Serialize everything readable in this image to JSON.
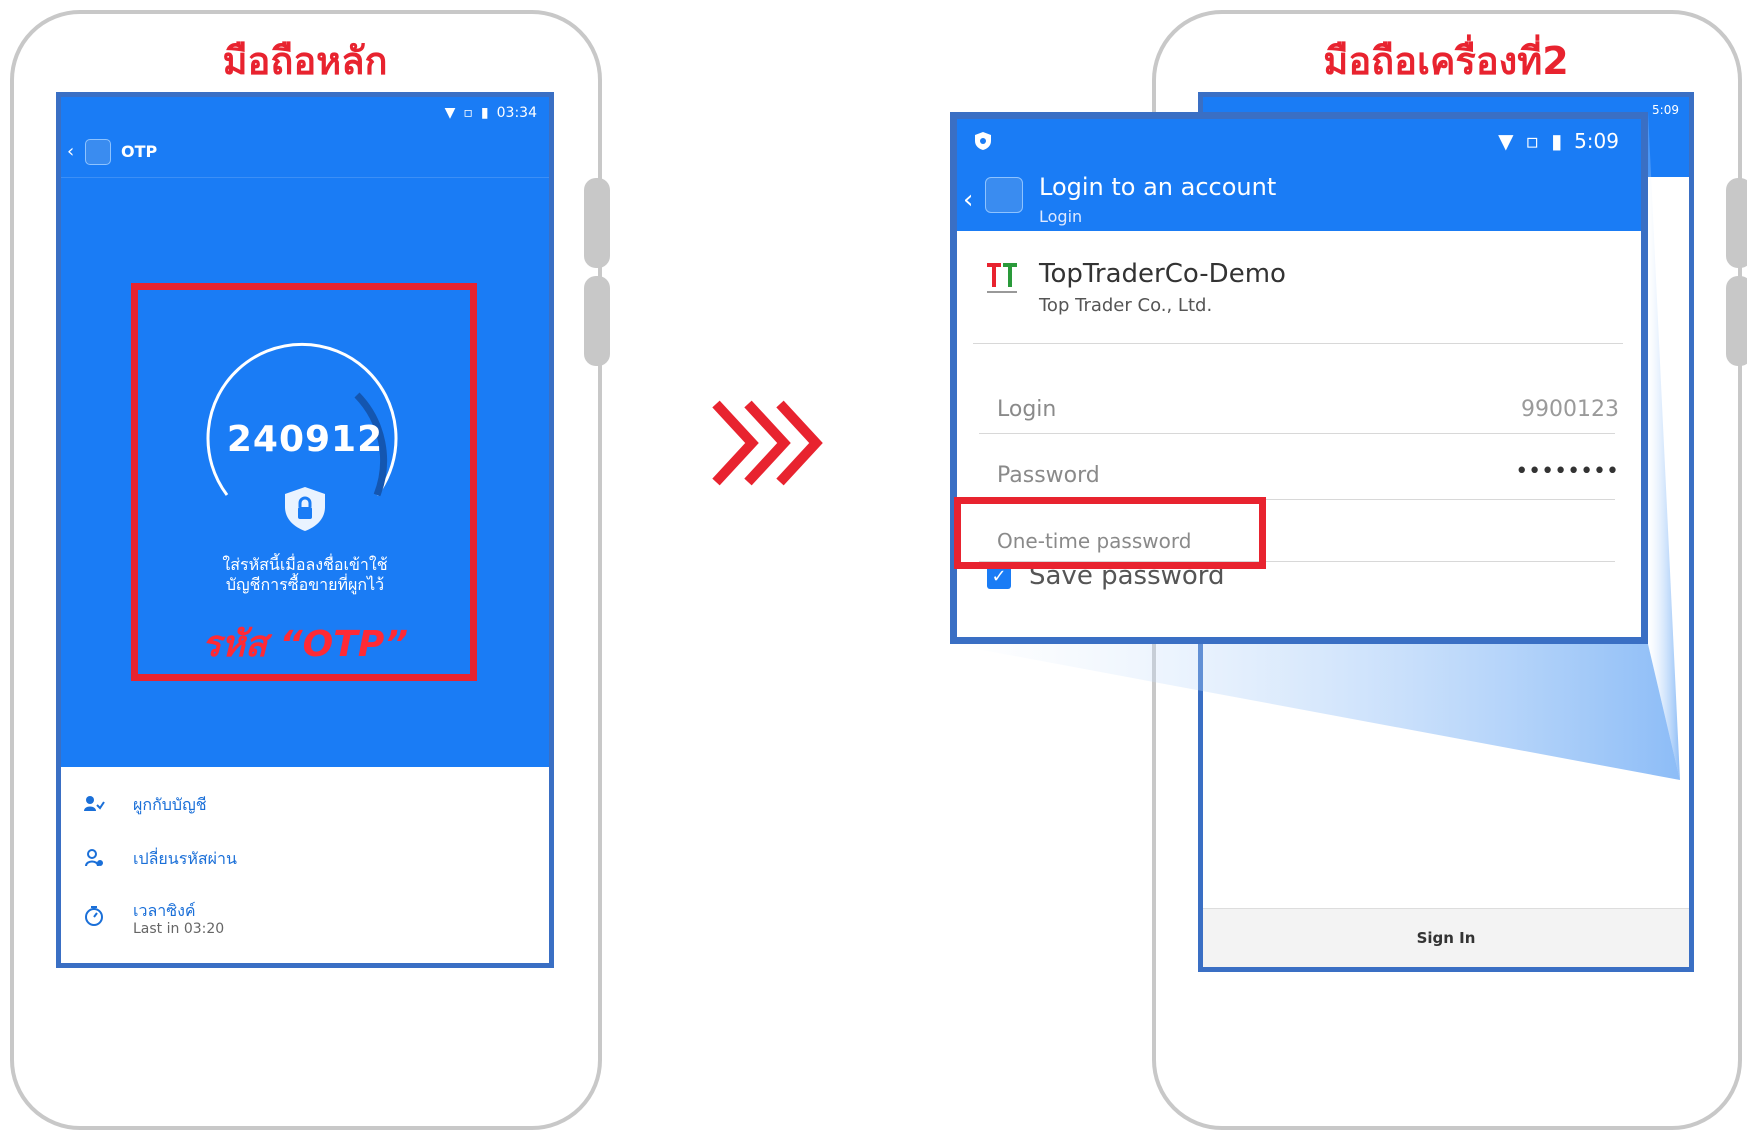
{
  "left_phone": {
    "caption": "มือถือหลัก",
    "status_time": "03:34",
    "app_title": "OTP",
    "otp_code": "240912",
    "otp_description_line1": "ใส่รหัสนี้เมื่อลงชื่อเข้าใช้",
    "otp_description_line2": "บัญชีการซื้อขายที่ผูกไว้",
    "otp_callout": "รหัส “OTP”",
    "menu": [
      {
        "label": "ผูกกับบัญชี",
        "icon": "person-link-icon"
      },
      {
        "label": "เปลี่ยนรหัสผ่าน",
        "icon": "key-user-icon"
      },
      {
        "label": "เวลาซิงค์",
        "sublabel": "Last in 03:20",
        "icon": "timer-icon"
      }
    ]
  },
  "right_phone": {
    "caption": "มือถือเครื่องที่2",
    "status_time_back": "5:09",
    "sign_in_label": "Sign In"
  },
  "zoom": {
    "status_time": "5:09",
    "title": "Login to an account",
    "subtitle": "Login",
    "broker_name": "TopTraderCo-Demo",
    "broker_company": "Top Trader Co., Ltd.",
    "login_label": "Login",
    "login_value": "9900123",
    "password_label": "Password",
    "password_value": "••••••••",
    "otp_label": "One-time password",
    "save_password_label": "Save password"
  },
  "colors": {
    "accent_red": "#e8232f",
    "app_blue": "#1a7cf5",
    "frame_blue": "#3a6fc4"
  }
}
